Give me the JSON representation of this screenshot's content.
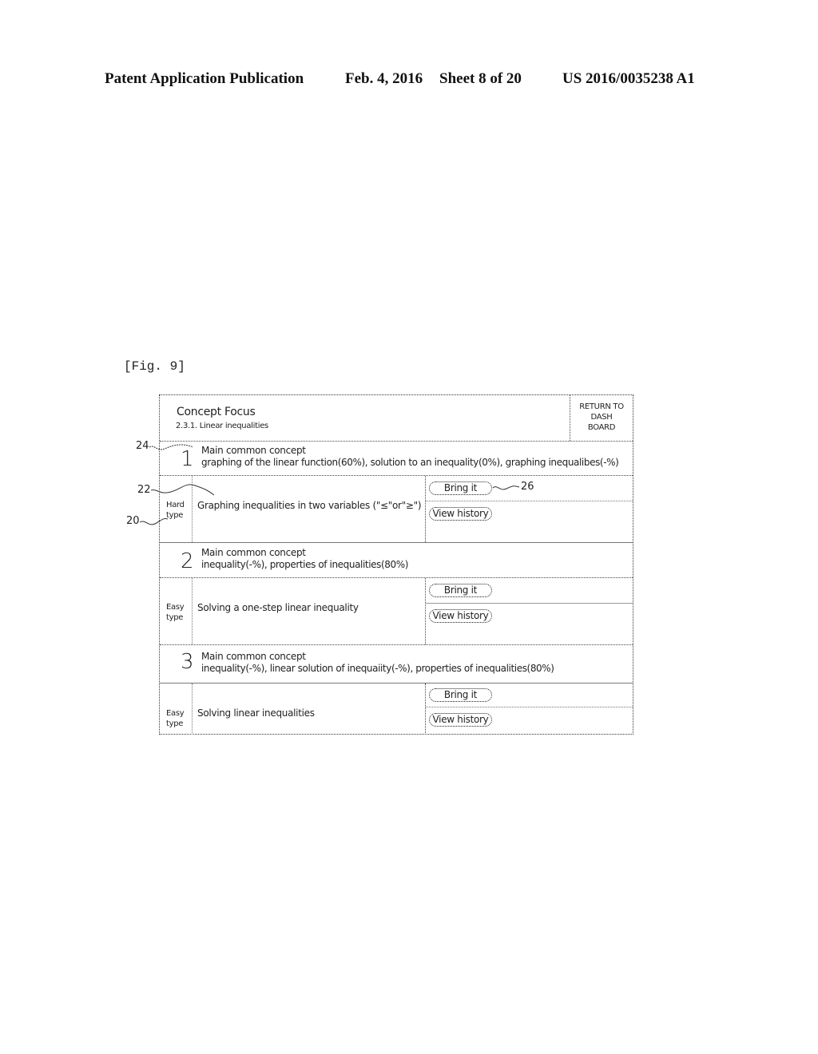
{
  "header": {
    "publication": "Patent Application Publication",
    "date": "Feb. 4, 2016",
    "sheet": "Sheet 8 of 20",
    "number": "US 2016/0035238 A1"
  },
  "figure_label": "[Fig. 9]",
  "screen": {
    "title": "Concept Focus",
    "subtitle": "2.3.1. Linear inequalities",
    "return_button": [
      "RETURN TO",
      "DASH",
      "BOARD"
    ],
    "groups": [
      {
        "number": "1",
        "concept_title": "Main common concept",
        "concepts": "graphing of the linear function(60%), solution to an inequality(0%), graphing inequalibes(-%)",
        "problem": {
          "type_lines": [
            "Hard",
            "type"
          ],
          "text": "Graphing inequalities in two variables (\"≤\"or\"≥\")",
          "bring_label": "Bring it",
          "history_label": "View history"
        }
      },
      {
        "number": "2",
        "concept_title": "Main common concept",
        "concepts": "inequality(-%), properties of inequalities(80%)",
        "problem": {
          "type_lines": [
            "Easy",
            "type"
          ],
          "text": "Solving a one-step linear inequality",
          "bring_label": "Bring it",
          "history_label": "View history"
        }
      },
      {
        "number": "3",
        "concept_title": "Main common concept",
        "concepts": "inequality(-%), linear solution of inequaiity(-%), properties of inequalities(80%)",
        "problem": {
          "type_lines": [
            "Easy",
            "type"
          ],
          "text": "Solving linear inequalities",
          "bring_label": "Bring it",
          "history_label": "View history"
        }
      }
    ]
  },
  "reference_numerals": {
    "concept_number": "24",
    "problem_text": "22",
    "problem_type": "20",
    "bring_button": "26"
  }
}
